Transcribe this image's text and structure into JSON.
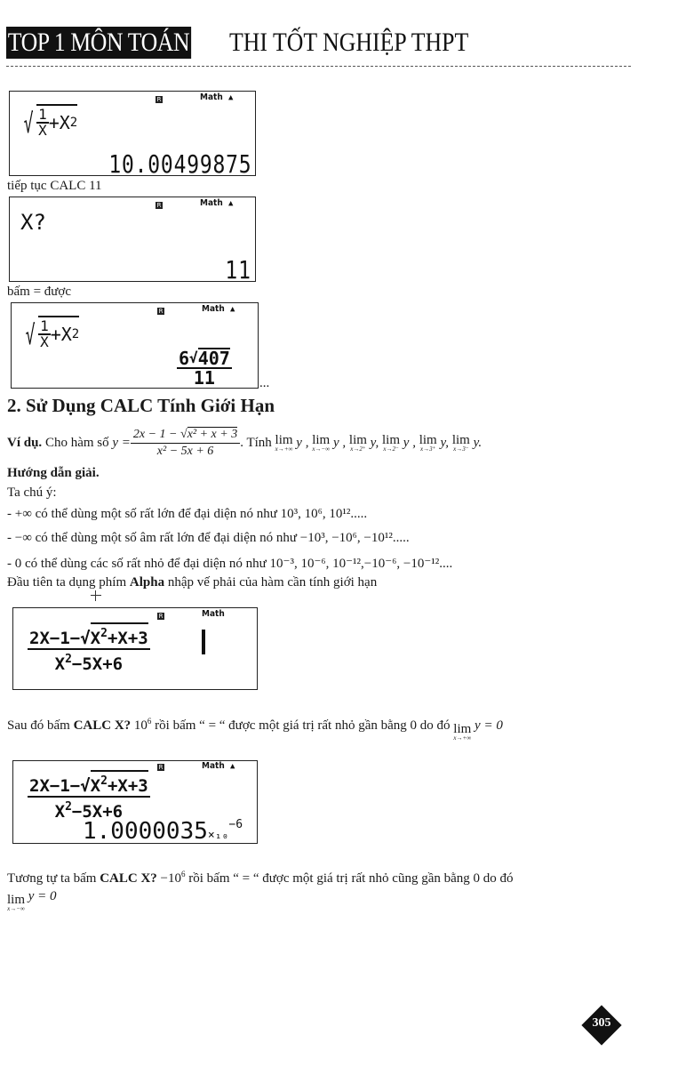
{
  "header": {
    "highlight": "TOP 1 MÔN TOÁN",
    "rest": "THI TỐT NGHIỆP THPT"
  },
  "calc1": {
    "indicator_r": "R",
    "indicator_mode": "Math",
    "indicator_arrow": "▲",
    "expr_num": "1",
    "expr_den": "X",
    "expr_plus": "+X",
    "expr_sup": "2",
    "result": "10.00499875"
  },
  "caption1": "tiếp tục CALC 11",
  "calc2": {
    "indicator_r": "R",
    "indicator_mode": "Math",
    "indicator_arrow": "▲",
    "prompt": "X?",
    "value": "11"
  },
  "caption2": "bấm = được",
  "calc3": {
    "indicator_r": "R",
    "indicator_mode": "Math",
    "indicator_arrow": "▲",
    "expr_num": "1",
    "expr_den": "X",
    "expr_plus": "+X",
    "expr_sup": "2",
    "result_num_coef": "6",
    "result_num_rad": "407",
    "result_den": "11",
    "ellipsis": "..."
  },
  "section": {
    "title": "2. Sử Dụng CALC Tính Giới Hạn",
    "example_label": "Ví dụ.",
    "example_text": "Cho hàm số",
    "fn_lhs": "y =",
    "fn_num_a": "2x − 1 − ",
    "fn_num_rad": "x² + x + 3",
    "fn_den": "x² − 5x + 6",
    "tinh": ". Tính",
    "limits": [
      {
        "op": "lim",
        "sub": "x→+∞",
        "after": "y ,"
      },
      {
        "op": "lim",
        "sub": "x→−∞",
        "after": "y ,"
      },
      {
        "op": "lim",
        "sub": "x→2⁺",
        "after": "y,"
      },
      {
        "op": "lim",
        "sub": "x→2⁻",
        "after": "y ,"
      },
      {
        "op": "lim",
        "sub": "x→3⁺",
        "after": "y,"
      },
      {
        "op": "lim",
        "sub": "x→3⁻",
        "after": "y."
      }
    ],
    "guide_title": "Hướng dẫn giải.",
    "note_intro": "Ta chú ý:",
    "bullets": [
      {
        "prefix": "- +∞ có thể dùng một số rất lớn để đại diện nó như ",
        "values": "10³, 10⁶, 10¹²....."
      },
      {
        "prefix": "- −∞ có thể dùng một số âm rất lớn để đại diện nó như ",
        "values": "−10³, −10⁶, −10¹²....."
      },
      {
        "prefix": "- 0 có thể dùng các số rất nhỏ để đại diện nó như ",
        "values": "10⁻³, 10⁻⁶, 10⁻¹²,−10⁻⁶, −10⁻¹²...."
      }
    ],
    "alpha_line_a": "Đầu tiên ta dụng phím ",
    "alpha_line_bold": "Alpha",
    "alpha_line_b": " nhập vế phải của hàm cần tính giới hạn"
  },
  "calc4": {
    "indicator_r": "R",
    "indicator_mode": "Math",
    "num_a": "2X−1−",
    "num_rad": "X",
    "num_sup": "2",
    "num_b": "+X+3",
    "den_a": "X",
    "den_sup": "2",
    "den_b": "−5X+6"
  },
  "para1": {
    "a": "Sau đó bấm ",
    "bold": "CALC X?",
    "b": " 10",
    "sup": "6",
    "c": "  rồi bấm “ = “ được một giá trị rất nhỏ gần bằng 0 do đó ",
    "lim": "lim",
    "lim_sub": "x→+∞",
    "d": " y = 0"
  },
  "calc5": {
    "indicator_r": "R",
    "indicator_mode": "Math",
    "indicator_arrow": "▲",
    "num_a": "2X−1−",
    "num_rad": "X",
    "num_sup": "2",
    "num_b": "+X+3",
    "den_a": "X",
    "den_sup": "2",
    "den_b": "−5X+6",
    "result": "1.0000035",
    "result_exp_base": "×₁₀",
    "result_exp": "−6"
  },
  "para2": {
    "a": "Tương tự ta bấm ",
    "bold": "CALC X?",
    "b": " −10",
    "sup": "6",
    "c": "  rồi bấm “ = “ được một giá trị rất nhỏ cũng gần bằng 0 do đó",
    "lim": "lim",
    "lim_sub": "x→−∞",
    "d": " y = 0"
  },
  "page_number": "305"
}
